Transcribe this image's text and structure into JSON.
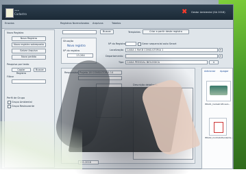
{
  "titlebar": {
    "logo_text_top": "•••",
    "logo_text_bottom": "Cadastro",
    "right_text": "Gestor Ambiental (GA 2018)"
  },
  "tabs": [
    {
      "label": "Ensaios"
    },
    {
      "label": "Registros Normalizados"
    },
    {
      "label": "Arquivos"
    },
    {
      "label": "Tabelas"
    }
  ],
  "left": {
    "menu_label": "Novo Registro",
    "buttons": [
      "Novo Registro",
      "Novo registro sobreposto",
      "Salvar Arquivo",
      "Novo pedido"
    ],
    "search_label": "Pesquisa por texto",
    "search_buttons": [
      "Copiar Registro",
      "Buscar"
    ],
    "filter_label": "Filtrar",
    "tree_label": "Perfil de Grupo",
    "tree_items": [
      "Grupo Ambiental",
      "Grupo Restaurante"
    ]
  },
  "top_row": {
    "search_placeholder": "",
    "ok_button": "Buscar",
    "template_label": "Templates",
    "template_button": "Criar a partir deste registro"
  },
  "record": {
    "status_label": "Situação",
    "status_value": "Novo registro",
    "number_label": "Nº do registro",
    "number_value": "13-264",
    "id_label": "Nº do Registro",
    "id_checkbox_label": "Gerar sequencial auto Smart",
    "location_label": "Localização",
    "location_value": "CAIXA 1 Ref.B CONSULTORIA 1",
    "dept_label": "Departamento",
    "tipo_label": "Tipo",
    "tipo_value": "CAIXA PESSOAL BIOLÓGICA",
    "responsible_label": "Responsável",
    "responsible_value": "Projeto 18 CONSULTORIA 14",
    "description_label": "Descrição detalhada",
    "date_value": "",
    "bottom_value": "100-2018"
  },
  "attachments": {
    "header_left": "Adicionar",
    "header_right": "Apagar",
    "items": [
      {
        "name": "IMG01_CadastroEnsaio..."
      },
      {
        "name": "IMG02_ContratoPendente..."
      }
    ]
  },
  "colors": {
    "accent_green": "#6bbf2e",
    "titlebar": "#1f2d39",
    "alert_red": "#ff3b2a"
  }
}
